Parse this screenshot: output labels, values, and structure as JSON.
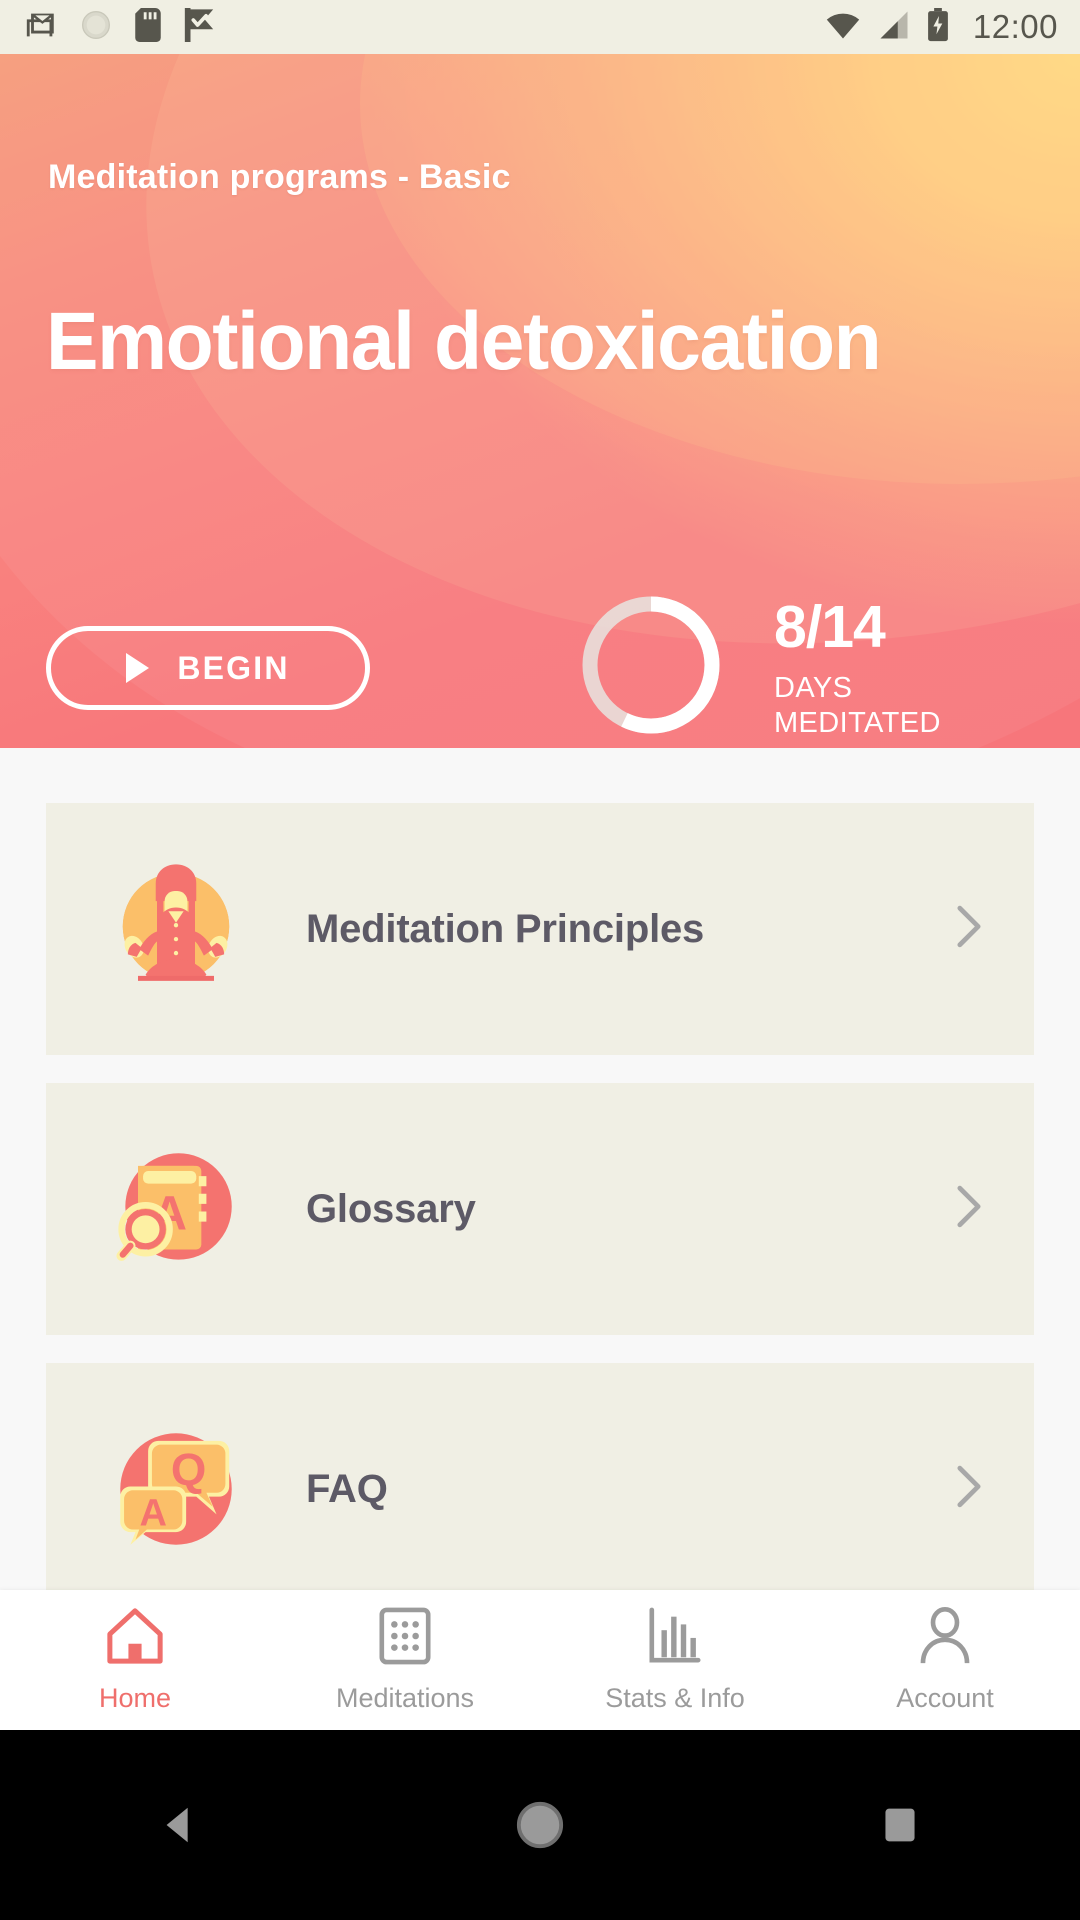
{
  "status_bar": {
    "time": "12:00",
    "left_icons": [
      "gmail-icon",
      "alarm-icon",
      "sd-card-icon",
      "checkmark-flag-icon"
    ],
    "right_icons": [
      "wifi-icon",
      "signal-icon",
      "battery-charging-icon"
    ],
    "background_color": "#f0efe3",
    "icon_color": "#57564d"
  },
  "header": {
    "breadcrumb": "Meditation programs - Basic",
    "title": "Emotional detoxication",
    "begin_button": {
      "label": "BEGIN",
      "icon": "play-icon"
    },
    "progress": {
      "value": 8,
      "total": 14,
      "count_text": "8/14",
      "caption_line1": "DAYS",
      "caption_line2": "MEDITATED",
      "percent": 57
    },
    "gradient_from": "#ffd979",
    "gradient_to": "#f7767b"
  },
  "list": {
    "items": [
      {
        "label": "Meditation Principles",
        "icon": "meditating-person-icon",
        "chevron": "chevron-right-icon"
      },
      {
        "label": "Glossary",
        "icon": "book-magnifier-icon",
        "chevron": "chevron-right-icon"
      },
      {
        "label": "FAQ",
        "icon": "speech-bubbles-qa-icon",
        "chevron": "chevron-right-icon"
      }
    ],
    "card_color": "#f0efe4",
    "background_color": "#f8f8f8"
  },
  "bottom_nav": {
    "active_color": "#ef6f6c",
    "idle_color": "#9b9b9b",
    "items": [
      {
        "label": "Home",
        "icon": "home-icon",
        "active": true
      },
      {
        "label": "Meditations",
        "icon": "grid-dots-icon",
        "active": false
      },
      {
        "label": "Stats & Info",
        "icon": "bar-chart-icon",
        "active": false
      },
      {
        "label": "Account",
        "icon": "person-icon",
        "active": false
      }
    ]
  },
  "android_nav": {
    "back": "back-triangle-icon",
    "home": "home-circle-icon",
    "recents": "recents-square-icon"
  }
}
